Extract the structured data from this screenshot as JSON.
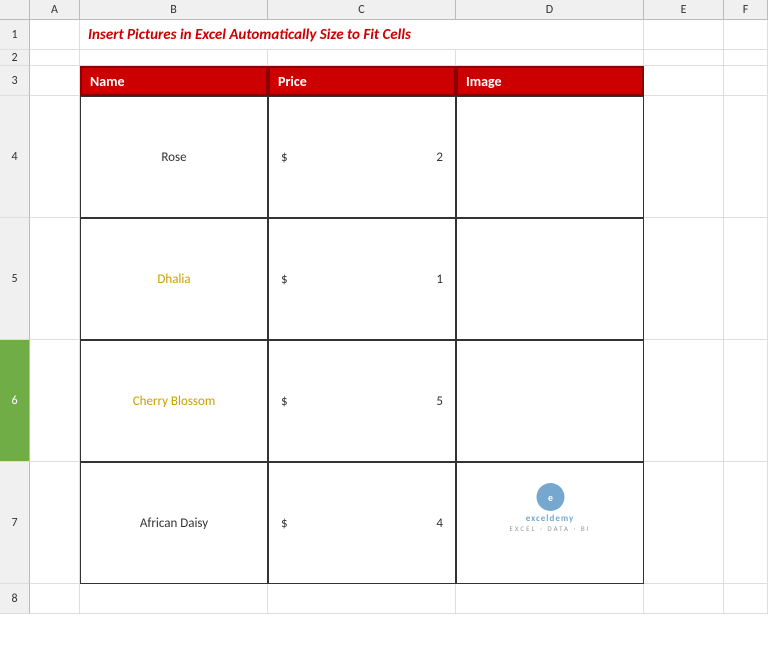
{
  "title": "Insert Pictures in Excel Automatically Size to Fit Cells",
  "columns": {
    "headers": [
      "",
      "A",
      "B",
      "C",
      "D",
      "E",
      "F"
    ]
  },
  "table": {
    "headers": {
      "name": "Name",
      "price": "Price",
      "image": "Image"
    },
    "rows": [
      {
        "id": 1,
        "name": "Rose",
        "name_color": "black",
        "price_symbol": "$",
        "price_value": "2"
      },
      {
        "id": 2,
        "name": "Dhalia",
        "name_color": "gold",
        "price_symbol": "$",
        "price_value": "1"
      },
      {
        "id": 3,
        "name": "Cherry Blossom",
        "name_color": "gold",
        "price_symbol": "$",
        "price_value": "5"
      },
      {
        "id": 4,
        "name": "African Daisy",
        "name_color": "black",
        "price_symbol": "$",
        "price_value": "4"
      }
    ]
  },
  "row_numbers": [
    "1",
    "2",
    "3",
    "4",
    "5",
    "6",
    "7",
    "8"
  ],
  "watermark": {
    "text": "exceldemy",
    "sub": "EXCEL · DATA · BI"
  }
}
